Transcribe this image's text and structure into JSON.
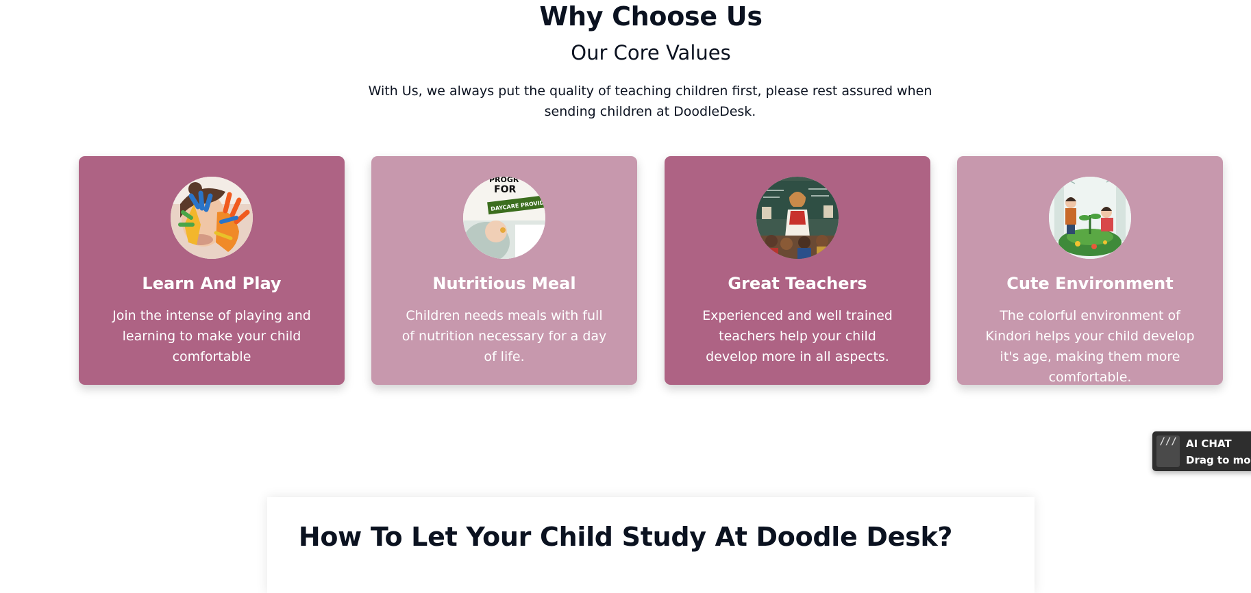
{
  "section": {
    "title": "Why Choose Us",
    "subtitle": "Our Core Values",
    "description": "With Us, we always put the quality of teaching children first, please rest assured when sending children at DoodleDesk."
  },
  "cards": [
    {
      "title": "Learn And Play",
      "text": "Join the intense of playing and learning to make your child comfortable",
      "image": "child-painted-hands-photo",
      "color": "#ae6384"
    },
    {
      "title": "Nutritious Meal",
      "text": "Children needs meals with full of nutrition necessary for a day of life.",
      "image": "daycare-meal-program-photo",
      "image_text_1": "FOR",
      "image_text_2": "DAYCARE PROVIDERS",
      "color": "#c798ad"
    },
    {
      "title": "Great Teachers",
      "text": "Experienced and well trained teachers help your child develop more in all aspects.",
      "image": "teacher-classroom-illustration",
      "color": "#ae6384"
    },
    {
      "title": "Cute Environment",
      "text": "The colorful environment of Kindori helps your child develop it's age, making them more comfortable.",
      "image": "kids-gardening-illustration",
      "color": "#c798ad"
    }
  ],
  "ai_chat": {
    "handle_icon": "///",
    "label": "AI CHAT",
    "hint": "Drag to move"
  },
  "how_to": {
    "title": "How To Let Your Child Study At Doodle Desk?"
  }
}
